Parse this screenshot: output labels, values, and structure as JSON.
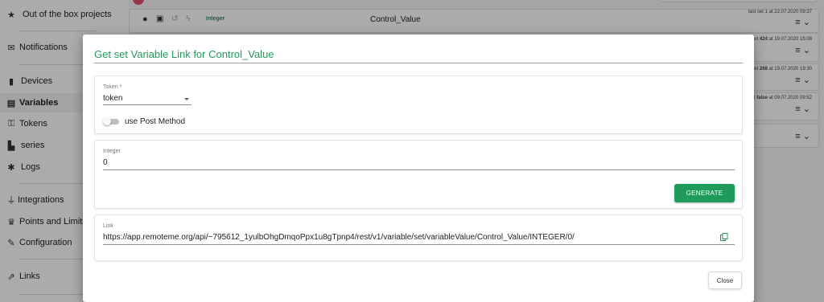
{
  "sidebar": {
    "items": [
      {
        "icon": "star-icon",
        "glyph": "★",
        "label": "Out of the box projects"
      },
      {
        "icon": "envelope-icon",
        "glyph": "✉",
        "label": "Notifications"
      },
      {
        "icon": "device-icon",
        "glyph": "▮",
        "label": "Devices"
      },
      {
        "icon": "variables-icon",
        "glyph": "▤",
        "label": "Variables"
      },
      {
        "icon": "key-icon",
        "glyph": "⚿",
        "label": "Tokens"
      },
      {
        "icon": "chart-icon",
        "glyph": "▙",
        "label": "series"
      },
      {
        "icon": "bug-icon",
        "glyph": "✱",
        "label": "Logs"
      },
      {
        "icon": "plug-icon",
        "glyph": "⏚",
        "label": "Integrations"
      },
      {
        "icon": "trophy-icon",
        "glyph": "♛",
        "label": "Points and Limits"
      },
      {
        "icon": "wrench-icon",
        "glyph": "✎",
        "label": "Configuration"
      },
      {
        "icon": "external-link-icon",
        "glyph": "⇗",
        "label": "Links"
      }
    ]
  },
  "background": {
    "row1": {
      "type": "Integer",
      "name": "Control_Value",
      "meta_prefix": "last set",
      "meta_value": "1",
      "meta_suffix": "at 22.07.2020 09:37"
    },
    "row2": {
      "meta_prefix": "et",
      "meta_value": "424",
      "meta_suffix": "at 19.07.2020 15:08"
    },
    "row3": {
      "meta_prefix": "et",
      "meta_value": "288",
      "meta_suffix": "at 19.07.2020 19:30"
    },
    "row4": {
      "meta_prefix": "t",
      "meta_value": "false",
      "meta_suffix": "at 09.07.2020 09:52"
    }
  },
  "dialog": {
    "title": "Get set Variable Link for Control_Value",
    "token": {
      "label": "Token *",
      "value": "token"
    },
    "post_method_label": "use Post Method",
    "integer": {
      "label": "Integer",
      "value": "0"
    },
    "generate_label": "GENERATE",
    "link": {
      "label": "Link",
      "value": "https://app.remoteme.org/api/~795612_1yulbOhgDmqoPpx1u8gTpnp4/rest/v1/variable/set/variableValue/Control_Value/INTEGER/0/"
    },
    "close_label": "Close"
  },
  "colors": {
    "accent": "#1e9b5a",
    "overlay": "rgba(0,0,0,0.33)"
  }
}
